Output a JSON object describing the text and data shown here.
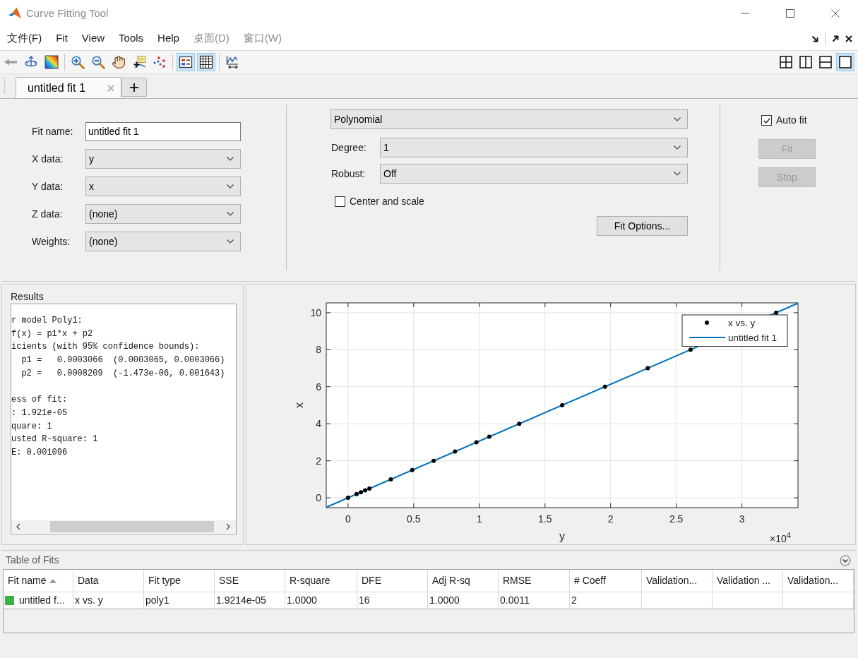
{
  "window": {
    "title": "Curve Fitting Tool"
  },
  "menu": [
    {
      "label": "文件(F)",
      "disabled": false
    },
    {
      "label": "Fit",
      "disabled": false
    },
    {
      "label": "View",
      "disabled": false
    },
    {
      "label": "Tools",
      "disabled": false
    },
    {
      "label": "Help",
      "disabled": false
    },
    {
      "label": "桌面(D)",
      "disabled": true
    },
    {
      "label": "窗口(W)",
      "disabled": true
    }
  ],
  "toolbar": {
    "groups": [
      [
        {
          "selected": false,
          "disabled": true
        },
        {
          "selected": false,
          "disabled": false
        },
        {
          "selected": false,
          "disabled": false
        }
      ],
      [
        {
          "selected": false,
          "disabled": false
        },
        {
          "selected": false,
          "disabled": false
        },
        {
          "selected": false,
          "disabled": false
        },
        {
          "selected": false,
          "disabled": false
        },
        {
          "selected": false,
          "disabled": false
        }
      ],
      [
        {
          "selected": true,
          "disabled": false
        },
        {
          "selected": true,
          "disabled": false
        }
      ],
      [
        {
          "selected": false,
          "disabled": false
        }
      ]
    ],
    "layouts": [
      {
        "selected": false
      },
      {
        "selected": false
      },
      {
        "selected": false
      },
      {
        "selected": true
      }
    ]
  },
  "tabs": [
    {
      "label": "untitled fit 1",
      "selected": true
    }
  ],
  "fit_settings": {
    "fields": [
      {
        "label": "Fit name:",
        "kind": "text",
        "value": "untitled fit 1"
      },
      {
        "label": "X data:",
        "kind": "select",
        "value": "y"
      },
      {
        "label": "Y data:",
        "kind": "select",
        "value": "x"
      },
      {
        "label": "Z data:",
        "kind": "select",
        "value": "(none)"
      },
      {
        "label": "Weights:",
        "kind": "select",
        "value": "(none)"
      }
    ],
    "fit_type": "Polynomial",
    "options": [
      {
        "label": "Degree:",
        "value": "1"
      },
      {
        "label": "Robust:",
        "value": "Off"
      }
    ],
    "center_and_scale": {
      "label": "Center and scale",
      "checked": false
    },
    "fit_options_button": "Fit Options...",
    "auto_fit": {
      "label": "Auto fit",
      "checked": true
    },
    "buttons": [
      {
        "label": "Fit",
        "disabled": true
      },
      {
        "label": "Stop",
        "disabled": true
      }
    ]
  },
  "results": {
    "title": "Results",
    "blocks": [
      [
        "r model Poly1:",
        "f(x) = p1*x + p2",
        "icients (with 95% confidence bounds):",
        "  p1 =   0.0003066  (0.0003065, 0.0003066)",
        "  p2 =   0.0008209  (-1.473e-06, 0.001643)"
      ],
      [
        "ess of fit:",
        ": 1.921e-05",
        "quare: 1",
        "usted R-square: 1",
        "E: 0.001096"
      ]
    ]
  },
  "plot": {
    "x_multiplier": {
      "base": "×10",
      "power": "4"
    },
    "chart_data": {
      "type": "scatter",
      "xlabel": "y",
      "ylabel": "x",
      "grid": true,
      "legend": "top right",
      "xlim": [
        -0.166,
        3.427
      ],
      "ylim": [
        -0.53,
        10.53
      ],
      "xticks": [
        {
          "value": 0,
          "label": "0"
        },
        {
          "value": 0.5,
          "label": "0.5"
        },
        {
          "value": 1,
          "label": "1"
        },
        {
          "value": 1.5,
          "label": "1.5"
        },
        {
          "value": 2,
          "label": "2"
        },
        {
          "value": 2.5,
          "label": "2.5"
        },
        {
          "value": 3,
          "label": "3"
        }
      ],
      "yticks": [
        {
          "value": 0,
          "label": "0"
        },
        {
          "value": 2,
          "label": "2"
        },
        {
          "value": 4,
          "label": "4"
        },
        {
          "value": 6,
          "label": "6"
        },
        {
          "value": 8,
          "label": "8"
        },
        {
          "value": 10,
          "label": "10"
        }
      ],
      "series": [
        {
          "name": "x vs. y",
          "type": "scatter",
          "color": "#000000",
          "x": [
            0,
            0.065,
            0.098,
            0.13,
            0.163,
            0.326,
            0.489,
            0.652,
            0.815,
            0.978,
            1.076,
            1.304,
            1.631,
            1.957,
            2.283,
            2.609,
            3.261
          ],
          "values": [
            0,
            0.2,
            0.3,
            0.4,
            0.5,
            1,
            1.5,
            2,
            2.5,
            3,
            3.3,
            4,
            5,
            6,
            7,
            8,
            10
          ]
        },
        {
          "name": "untitled fit 1",
          "type": "line",
          "color": "#0072bd",
          "x": [
            -0.166,
            3.427
          ],
          "values": [
            -0.51,
            10.51
          ]
        }
      ]
    }
  },
  "table_of_fits": {
    "title": "Table of Fits",
    "columns": [
      {
        "label": "Fit name",
        "sorted": true
      },
      {
        "label": "Data",
        "sorted": false
      },
      {
        "label": "Fit type",
        "sorted": false
      },
      {
        "label": "SSE",
        "sorted": false
      },
      {
        "label": "R-square",
        "sorted": false
      },
      {
        "label": "DFE",
        "sorted": false
      },
      {
        "label": "Adj R-sq",
        "sorted": false
      },
      {
        "label": "RMSE",
        "sorted": false
      },
      {
        "label": "# Coeff",
        "sorted": false
      },
      {
        "label": "Validation...",
        "sorted": false
      },
      {
        "label": "Validation ...",
        "sorted": false
      },
      {
        "label": "Validation...",
        "sorted": false
      }
    ],
    "rows": [
      {
        "color": "#3cb043",
        "selected": false,
        "cells": [
          "untitled f...",
          "x vs. y",
          "poly1",
          "1.9214e-05",
          "1.0000",
          "16",
          "1.0000",
          "0.0011",
          "2"
        ]
      }
    ]
  }
}
